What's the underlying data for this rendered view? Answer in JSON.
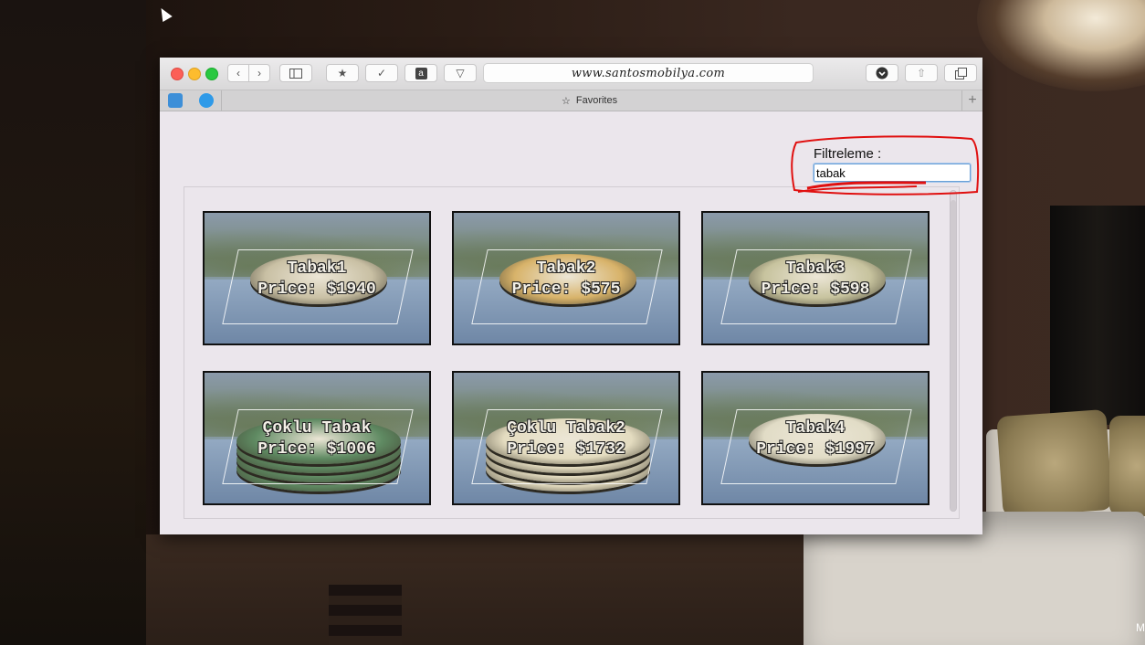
{
  "browser": {
    "url": "www.santosmobilya.com",
    "favorites_label": "Favorites",
    "new_tab_symbol": "+"
  },
  "filter": {
    "label": "Filtreleme :",
    "value": "tabak"
  },
  "products": [
    {
      "name": "Tabak1",
      "price": "Price: $1940",
      "plate_color": "#c9c0a4",
      "stack": 1
    },
    {
      "name": "Tabak2",
      "price": "Price: $575",
      "plate_color": "#d8b36a",
      "stack": 1
    },
    {
      "name": "Tabak3",
      "price": "Price: $598",
      "plate_color": "#c7c39e",
      "stack": 1
    },
    {
      "name": "Çoklu Tabak",
      "price": "Price: $1006",
      "plate_color": "#5f8a62",
      "stack": 4
    },
    {
      "name": "Çoklu Tabak2",
      "price": "Price: $1732",
      "plate_color": "#e4dcc0",
      "stack": 4
    },
    {
      "name": "Tabak4",
      "price": "Price: $1997",
      "plate_color": "#e1dcc6",
      "stack": 1
    }
  ],
  "colors": {
    "accent_red": "#e01010",
    "input_focus": "#6aa0d6"
  }
}
